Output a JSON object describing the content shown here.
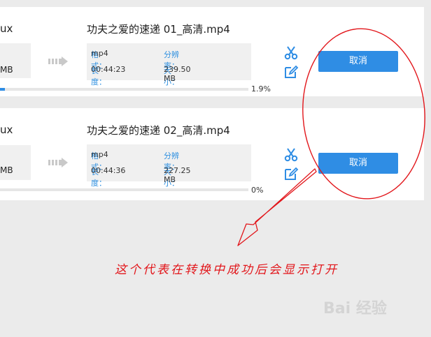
{
  "items": [
    {
      "source_name_fragment": "ux",
      "source_size_fragment": "MB",
      "title": "功夫之爱的速递 01_高清.mp4",
      "format_label": "格式：",
      "format_value": "mp4",
      "resolution_label": "分辨率：",
      "resolution_value": "",
      "duration_label": "长度：",
      "duration_value": "00:44:23",
      "size_label": "大小：",
      "size_value": "239.50 MB",
      "cancel_label": "取消",
      "progress_text": "1.9%",
      "progress_fraction": 0.019
    },
    {
      "source_name_fragment": "ux",
      "source_size_fragment": "MB",
      "title": "功夫之爱的速递 02_高清.mp4",
      "format_label": "格式：",
      "format_value": "mp4",
      "resolution_label": "分辨率：",
      "resolution_value": "",
      "duration_label": "长度：",
      "duration_value": "00:44:36",
      "size_label": "大小：",
      "size_value": "227.25 MB",
      "cancel_label": "取消",
      "progress_text": "0%",
      "progress_fraction": 0.0
    }
  ],
  "annotation": {
    "text": "这个代表在转换中成功后会显示打开",
    "color": "#e2161b"
  },
  "watermark": {
    "text": "Bai 经验"
  },
  "icons": [
    "scissors-icon",
    "edit-icon",
    "arrow-right-icon"
  ],
  "colors": {
    "accent": "#2f8de4",
    "background": "#ebebeb",
    "annotation": "#e2161b"
  }
}
